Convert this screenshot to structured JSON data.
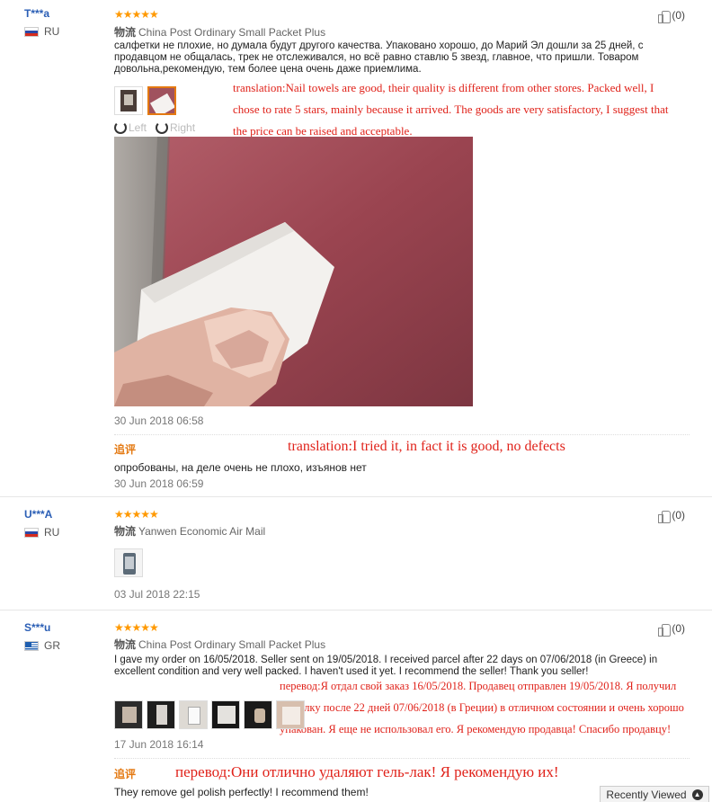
{
  "reviews": [
    {
      "user": "T***a",
      "country": "RU",
      "stars": "★★★★★",
      "shipping_label": "物流",
      "shipping": "China Post Ordinary Small Packet Plus",
      "text": "салфетки не плохие, но думала будут другого качества. Упаковано хорошо, до Марий Эл дошли за 25 дней, с продавцом не общалась, трек не отслеживался, но всё равно ставлю 5 звезд, главное, что пришли. Товаром довольна,рекомендую, тем более цена очень даже приемлима.",
      "translation": "translation:Nail towels are good, their quality is different from other stores. Packed well, I chose to rate 5 stars, mainly because it arrived. The goods are very satisfactory, I suggest that the price can be raised and acceptable.",
      "rotate_left": "Left",
      "rotate_right": "Right",
      "date": "30 Jun 2018 06:58",
      "helpful": "(0)",
      "additional_label": "追评",
      "additional_translation": "translation:I tried it, in fact it is good, no defects",
      "additional_text": "опробованы, на деле очень не плохо, изъянов нет",
      "additional_date": "30 Jun 2018 06:59"
    },
    {
      "user": "U***A",
      "country": "RU",
      "stars": "★★★★★",
      "shipping_label": "物流",
      "shipping": "Yanwen Economic Air Mail",
      "date": "03 Jul 2018 22:15",
      "helpful": "(0)"
    },
    {
      "user": "S***u",
      "country": "GR",
      "stars": "★★★★★",
      "shipping_label": "物流",
      "shipping": "China Post Ordinary Small Packet Plus",
      "text": "I gave my order on 16/05/2018. Seller sent on 19/05/2018. I received parcel after 22 days on 07/06/2018 (in Greece) in excellent condition and very well packed. I haven't used it yet. I recommend the seller! Thank you seller!",
      "translation": "перевод:Я отдал свой заказ 16/05/2018. Продавец отправлен 19/05/2018. Я получил посылку после 22 дней 07/06/2018 (в Греции) в отличном состоянии и очень хорошо упакован. Я еще не использовал его. Я рекомендую продавца! Спасибо продавцу!",
      "date": "17 Jun 2018 16:14",
      "helpful": "(0)",
      "additional_label": "追评",
      "additional_translation": "перевод:Они отлично удаляют гель-лак! Я рекомендую их!",
      "additional_text": "They remove gel polish perfectly! I recommend them!"
    }
  ],
  "recently_viewed": "Recently Viewed",
  "colors": {
    "accent": "#e47911",
    "star": "#ff9900",
    "username": "#2a5eb5",
    "translation": "#e0221a"
  }
}
